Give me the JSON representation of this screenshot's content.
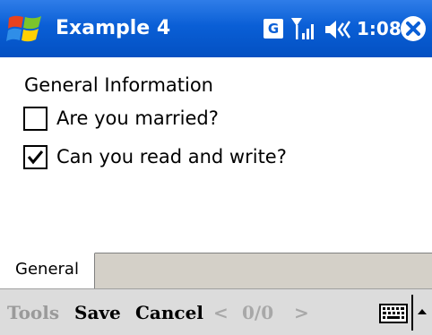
{
  "window": {
    "title": "Example 4",
    "clock": "1:08",
    "network_badge": "G",
    "icons": {
      "start": "windows-flag-icon",
      "signal": "signal-strength-icon",
      "volume": "speaker-volume-icon",
      "close": "close-icon"
    }
  },
  "form": {
    "heading": "General Information",
    "checkboxes": [
      {
        "label": "Are you married?",
        "checked": false
      },
      {
        "label": "Can you read and write?",
        "checked": true
      }
    ]
  },
  "tabs": [
    {
      "label": "General",
      "active": true
    }
  ],
  "menubar": {
    "tools": "Tools",
    "save": "Save",
    "cancel": "Cancel",
    "prev": "<",
    "counter": "0/0",
    "next": ">",
    "keyboard_icon": "keyboard-icon",
    "sip_arrow_icon": "arrow-up-icon"
  },
  "colors": {
    "titlebar": "#0a5fd6",
    "menubar": "#dcdcdc",
    "tabstrip": "#d4d0c8",
    "disabled_text": "#a8a8a8"
  }
}
